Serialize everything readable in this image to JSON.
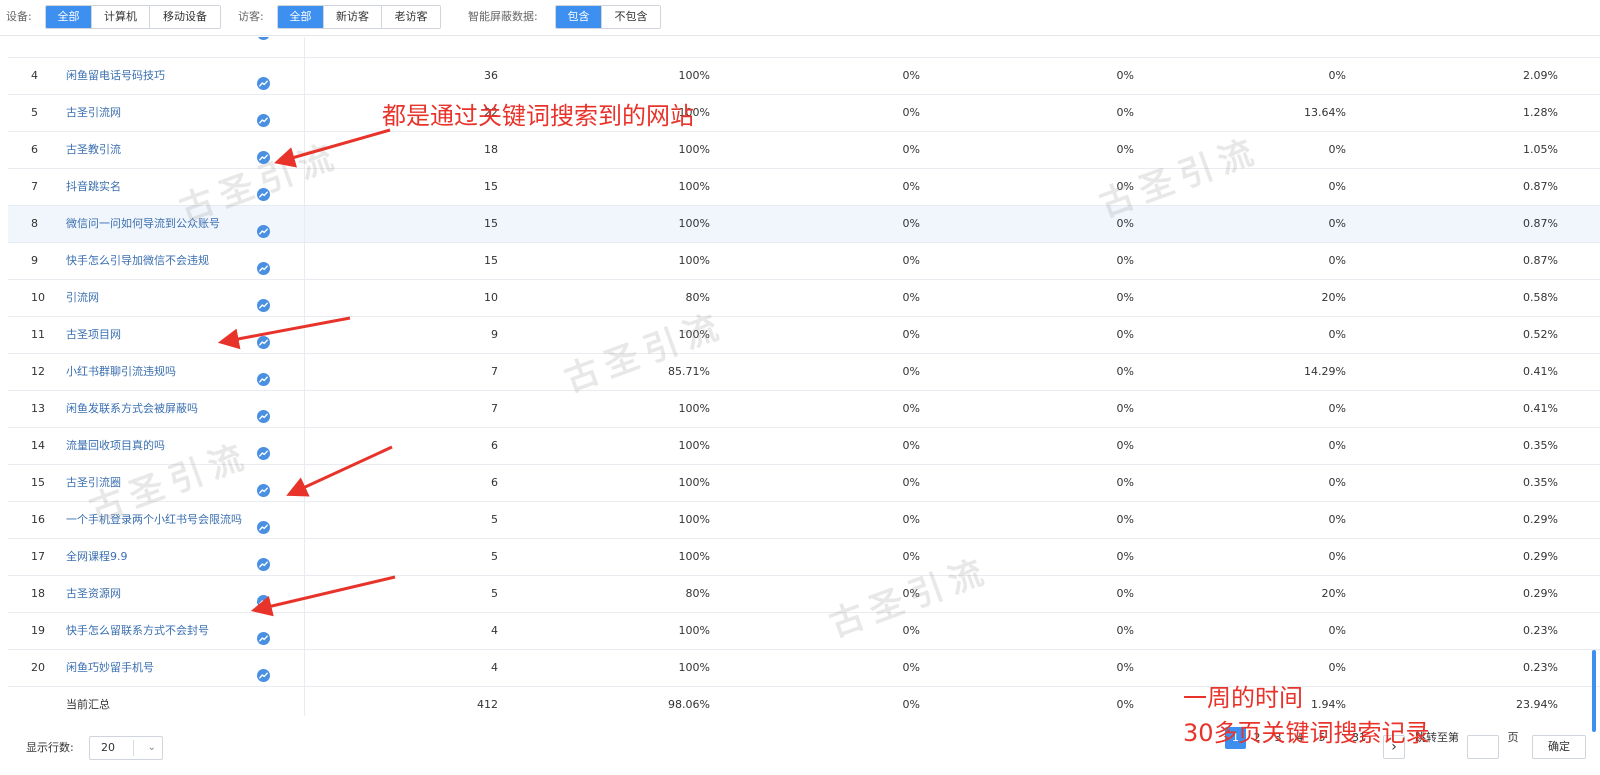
{
  "filters": {
    "device": {
      "label": "设备:",
      "options": [
        "全部",
        "计算机",
        "移动设备"
      ],
      "selected": 0
    },
    "visitor": {
      "label": "访客:",
      "options": [
        "全部",
        "新访客",
        "老访客"
      ],
      "selected": 0
    },
    "smart": {
      "label": "智能屏蔽数据:",
      "options": [
        "包含",
        "不包含"
      ],
      "selected": 0
    }
  },
  "rows": [
    {
      "idx": "4",
      "kw": "闲鱼留电话号码技巧",
      "pv": "36",
      "c1": "100%",
      "c2": "0%",
      "c3": "0%",
      "c4": "0%",
      "c5": "2.09%"
    },
    {
      "idx": "5",
      "kw": "古圣引流网",
      "pv": "22",
      "c1": "100%",
      "c2": "0%",
      "c3": "0%",
      "c4": "13.64%",
      "c5": "1.28%"
    },
    {
      "idx": "6",
      "kw": "古圣教引流",
      "pv": "18",
      "c1": "100%",
      "c2": "0%",
      "c3": "0%",
      "c4": "0%",
      "c5": "1.05%"
    },
    {
      "idx": "7",
      "kw": "抖音跳实名",
      "pv": "15",
      "c1": "100%",
      "c2": "0%",
      "c3": "0%",
      "c4": "0%",
      "c5": "0.87%"
    },
    {
      "idx": "8",
      "kw": "微信问一问如何导流到公众账号",
      "pv": "15",
      "c1": "100%",
      "c2": "0%",
      "c3": "0%",
      "c4": "0%",
      "c5": "0.87%"
    },
    {
      "idx": "9",
      "kw": "快手怎么引导加微信不会违规",
      "pv": "15",
      "c1": "100%",
      "c2": "0%",
      "c3": "0%",
      "c4": "0%",
      "c5": "0.87%"
    },
    {
      "idx": "10",
      "kw": "引流网",
      "pv": "10",
      "c1": "80%",
      "c2": "0%",
      "c3": "0%",
      "c4": "20%",
      "c5": "0.58%"
    },
    {
      "idx": "11",
      "kw": "古圣项目网",
      "pv": "9",
      "c1": "100%",
      "c2": "0%",
      "c3": "0%",
      "c4": "0%",
      "c5": "0.52%"
    },
    {
      "idx": "12",
      "kw": "小红书群聊引流违规吗",
      "pv": "7",
      "c1": "85.71%",
      "c2": "0%",
      "c3": "0%",
      "c4": "14.29%",
      "c5": "0.41%"
    },
    {
      "idx": "13",
      "kw": "闲鱼发联系方式会被屏蔽吗",
      "pv": "7",
      "c1": "100%",
      "c2": "0%",
      "c3": "0%",
      "c4": "0%",
      "c5": "0.41%"
    },
    {
      "idx": "14",
      "kw": "流量回收项目真的吗",
      "pv": "6",
      "c1": "100%",
      "c2": "0%",
      "c3": "0%",
      "c4": "0%",
      "c5": "0.35%"
    },
    {
      "idx": "15",
      "kw": "古圣引流圈",
      "pv": "6",
      "c1": "100%",
      "c2": "0%",
      "c3": "0%",
      "c4": "0%",
      "c5": "0.35%"
    },
    {
      "idx": "16",
      "kw": "一个手机登录两个小红书号会限流吗",
      "pv": "5",
      "c1": "100%",
      "c2": "0%",
      "c3": "0%",
      "c4": "0%",
      "c5": "0.29%"
    },
    {
      "idx": "17",
      "kw": "全网课程9.9",
      "pv": "5",
      "c1": "100%",
      "c2": "0%",
      "c3": "0%",
      "c4": "0%",
      "c5": "0.29%"
    },
    {
      "idx": "18",
      "kw": "古圣资源网",
      "pv": "5",
      "c1": "80%",
      "c2": "0%",
      "c3": "0%",
      "c4": "20%",
      "c5": "0.29%"
    },
    {
      "idx": "19",
      "kw": "快手怎么留联系方式不会封号",
      "pv": "4",
      "c1": "100%",
      "c2": "0%",
      "c3": "0%",
      "c4": "0%",
      "c5": "0.23%"
    },
    {
      "idx": "20",
      "kw": "闲鱼巧妙留手机号",
      "pv": "4",
      "c1": "100%",
      "c2": "0%",
      "c3": "0%",
      "c4": "0%",
      "c5": "0.23%"
    }
  ],
  "summary": {
    "label": "当前汇总",
    "pv": "412",
    "c1": "98.06%",
    "c2": "0%",
    "c3": "0%",
    "c4": "1.94%",
    "c5": "23.94%"
  },
  "footer": {
    "rows_label": "显示行数:",
    "rows_value": "20",
    "pages": [
      "1",
      "2",
      "3",
      "4",
      "5"
    ],
    "ellipsis": "···",
    "last_page": "31",
    "next": "›",
    "jump_label": "跳转至第",
    "page_unit": "页",
    "confirm": "确定"
  },
  "annotations": {
    "top": "都是通过关键词搜索到的网站",
    "bottom_line1": "一周的时间",
    "bottom_line2": "30多页关键词搜索记录"
  },
  "watermark": "古圣引流",
  "colors": {
    "accent": "#3d8ff0",
    "link": "#3a6fb0",
    "annotation": "#e8332b"
  },
  "icons": {
    "trend": "trend-chart-icon"
  }
}
